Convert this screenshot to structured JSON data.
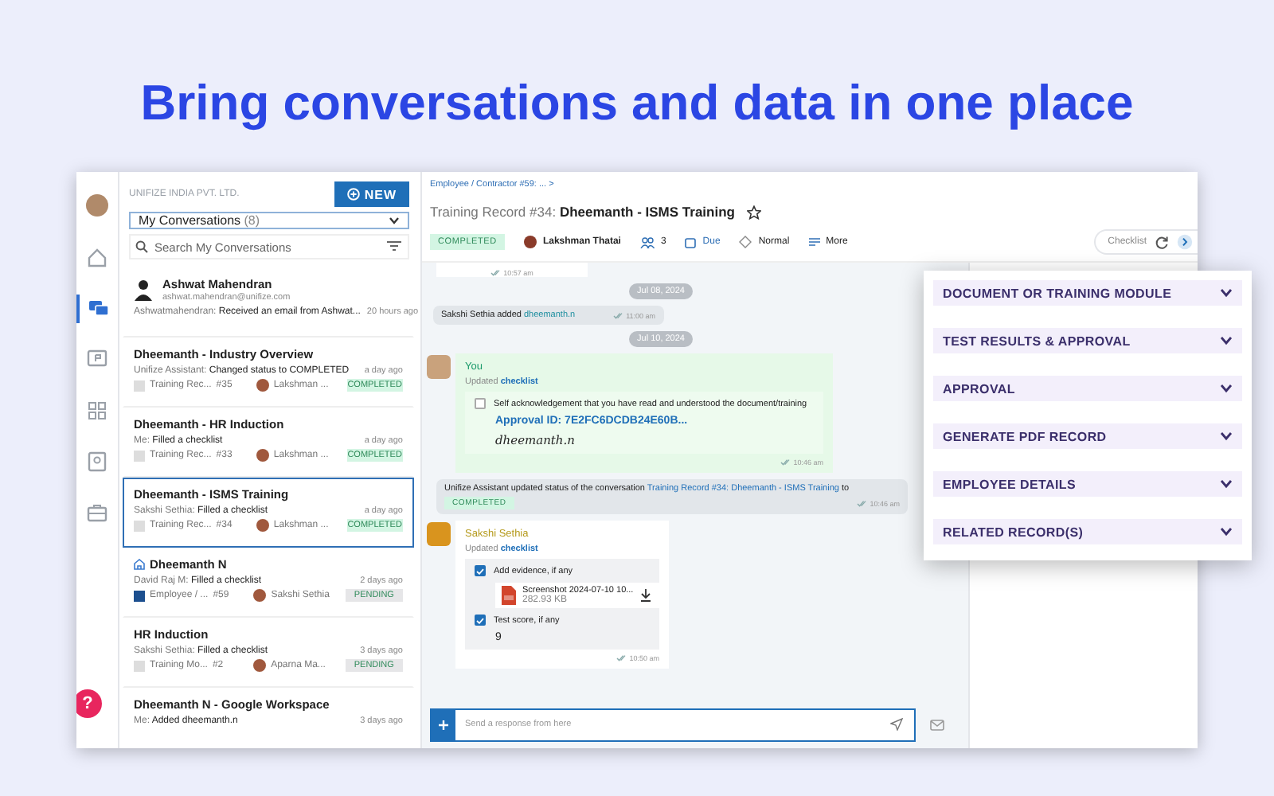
{
  "headline": "Bring conversations and data in one place",
  "rail": [
    {
      "kind": "home",
      "selected": false
    },
    {
      "kind": "chats",
      "selected": true
    },
    {
      "kind": "comment",
      "selected": false
    },
    {
      "kind": "grid",
      "selected": false
    },
    {
      "kind": "contact",
      "selected": false
    },
    {
      "kind": "briefcase",
      "selected": false
    }
  ],
  "help": "?",
  "org": "UNIFIZE INDIA PVT. LTD.",
  "new_button": "NEW",
  "filter": {
    "label": "My Conversations",
    "count": "(8)"
  },
  "search": {
    "placeholder": "Search My Conversations"
  },
  "conversations": [
    {
      "kind": "contact",
      "title": "Ashwat Mahendran",
      "email": "ashwat.mahendran@unifize.com",
      "author": "Ashwatmahendran:",
      "message": "Received an email from Ashwat...",
      "time": "20 hours ago",
      "selected": false
    },
    {
      "kind": "process",
      "title": "Dheemanth - Industry Overview",
      "author": "Unifize Assistant:",
      "message": "Changed status to COMPLETED",
      "time": "a day ago",
      "process": "Training Rec...",
      "number": "#35",
      "assignee": "Lakshman ...",
      "status": "COMPLETED",
      "color": "#d3f5e3",
      "marked": false,
      "selected": false
    },
    {
      "kind": "process",
      "title": "Dheemanth - HR Induction",
      "author": "Me:",
      "message": "Filled a checklist",
      "time": "a day ago",
      "process": "Training Rec...",
      "number": "#33",
      "assignee": "Lakshman ...",
      "status": "COMPLETED",
      "color": "#d3f5e3",
      "marked": false,
      "selected": false
    },
    {
      "kind": "process",
      "title": "Dheemanth - ISMS Training",
      "author": "Sakshi Sethia:",
      "message": "Filled a checklist",
      "time": "a day ago",
      "process": "Training Rec...",
      "number": "#34",
      "assignee": "Lakshman ...",
      "status": "COMPLETED",
      "color": "#d3f5e3",
      "marked": false,
      "selected": true
    },
    {
      "kind": "process",
      "title": "Dheemanth N",
      "author": "David Raj M:",
      "message": "Filled a checklist",
      "time": "2 days ago",
      "process": "Employee / ...",
      "number": "#59",
      "assignee": "Sakshi Sethia",
      "status": "PENDING",
      "color": "#e6e6e8",
      "marked": true,
      "selected": false
    },
    {
      "kind": "process",
      "title": "HR Induction",
      "author": "Sakshi Sethia:",
      "message": "Filled a checklist",
      "time": "3 days ago",
      "process": "Training Mo...",
      "number": "#2",
      "assignee": "Aparna Ma...",
      "status": "PENDING",
      "color": "#e6e6e8",
      "marked": false,
      "selected": false
    },
    {
      "kind": "process",
      "title": "Dheemanth N - Google Workspace",
      "author": "Me:",
      "message": "Added dheemanth.n",
      "time": "3 days ago",
      "marked": false,
      "selected": false
    }
  ],
  "header": {
    "breadcrumb": "Employee / Contractor #59: ... >",
    "record": "Training Record #34:",
    "name": "Dheemanth - ISMS Training",
    "starred": false,
    "status": "COMPLETED",
    "owner": "Lakshman Thatai",
    "members": "3",
    "due": "Due",
    "priority": "Normal",
    "more": "More",
    "checklist": "Checklist"
  },
  "messages": [
    {
      "kind": "tail",
      "time": "10:57 am"
    },
    {
      "kind": "date",
      "text": "Jul 08, 2024"
    },
    {
      "kind": "system",
      "text": "Sakshi Sethia added",
      "link": "dheemanth.n",
      "time": "11:00 am"
    },
    {
      "kind": "date",
      "text": "Jul 10, 2024"
    },
    {
      "kind": "checklist",
      "mine": true,
      "author": "You",
      "action": "Updated",
      "link": "checklist",
      "time": "10:46 am",
      "items": [
        {
          "kind": "ack",
          "checked": false,
          "label": "Self acknowledgement that you have read and understood the document/training",
          "approval_label": "Approval ID:",
          "approval": "7E2FC6DCDB24E60B...",
          "signature": "dheemanth.n"
        }
      ]
    },
    {
      "kind": "status",
      "text": "Unifize Assistant updated status of the conversation",
      "link": "Training Record #34: Dheemanth - ISMS Training",
      "after": "to",
      "badge": "COMPLETED",
      "time": "10:46 am"
    },
    {
      "kind": "checklist",
      "mine": false,
      "author": "Sakshi Sethia",
      "action": "Updated",
      "link": "checklist",
      "time": "10:50 am",
      "items": [
        {
          "kind": "file",
          "checked": true,
          "label": "Add evidence, if any",
          "file": "Screenshot 2024-07-10 10...",
          "size": "282.93 KB"
        },
        {
          "kind": "value",
          "checked": true,
          "label": "Test score, if any",
          "value": "9"
        }
      ]
    }
  ],
  "composer": {
    "placeholder": "Send a response from here"
  },
  "sections": [
    {
      "label": "DOCUMENT OR TRAINING MODULE",
      "expanded": false
    },
    {
      "label": "TEST RESULTS & APPROVAL",
      "expanded": false
    },
    {
      "label": "APPROVAL",
      "expanded": false
    },
    {
      "label": "GENERATE PDF RECORD",
      "expanded": false
    },
    {
      "label": "EMPLOYEE DETAILS",
      "expanded": false
    },
    {
      "label": "RELATED RECORD(S)",
      "expanded": false
    }
  ]
}
